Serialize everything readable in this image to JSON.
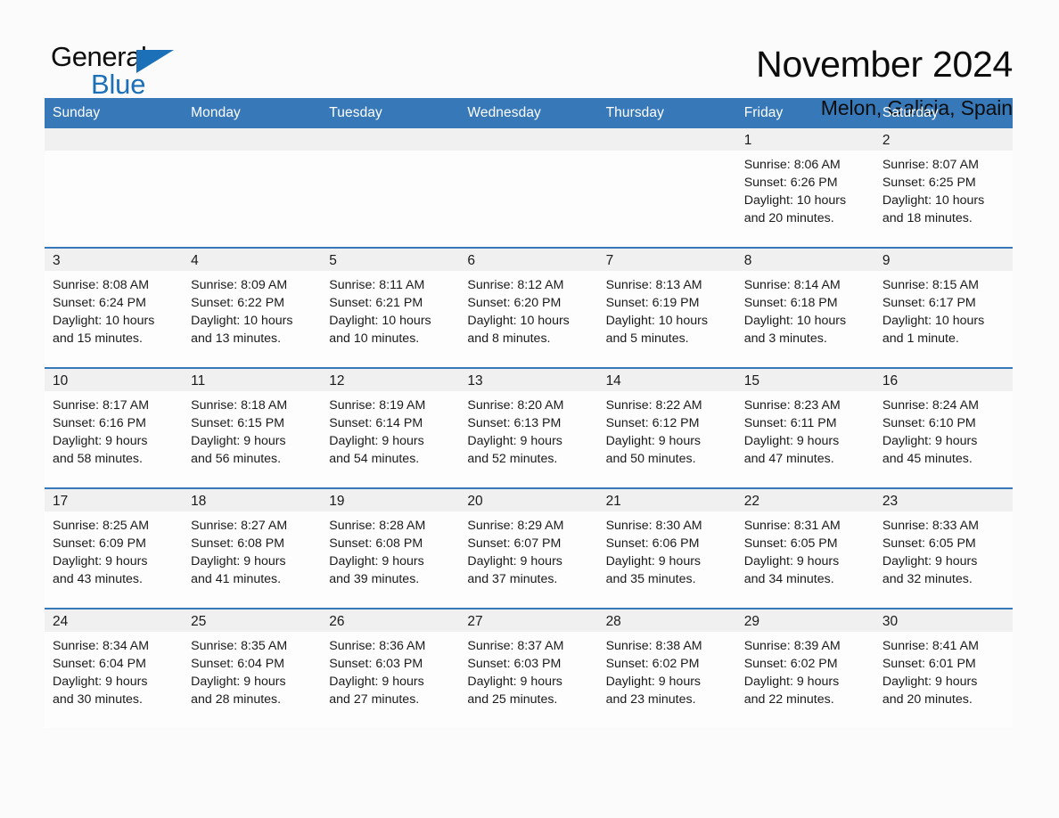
{
  "logo": {
    "word_one": "General",
    "word_two": "Blue",
    "triangle_color": "#1b70b8",
    "text_color": "#0d0d0d"
  },
  "header": {
    "month_title": "November 2024",
    "location": "Melon, Galicia, Spain"
  },
  "theme": {
    "header_blue": "#3778b9",
    "daynum_band": "#f0f0f0",
    "page_background": "#fbfbfb",
    "cell_background": "#fdfdfd",
    "text": "#1a1a1a"
  },
  "weekday_headers": [
    "Sunday",
    "Monday",
    "Tuesday",
    "Wednesday",
    "Thursday",
    "Friday",
    "Saturday"
  ],
  "weeks": [
    [
      {
        "day": "",
        "empty": true
      },
      {
        "day": "",
        "empty": true
      },
      {
        "day": "",
        "empty": true
      },
      {
        "day": "",
        "empty": true
      },
      {
        "day": "",
        "empty": true
      },
      {
        "day": "1",
        "sunrise": "Sunrise: 8:06 AM",
        "sunset": "Sunset: 6:26 PM",
        "daylight_line1": "Daylight: 10 hours",
        "daylight_line2": "and 20 minutes."
      },
      {
        "day": "2",
        "sunrise": "Sunrise: 8:07 AM",
        "sunset": "Sunset: 6:25 PM",
        "daylight_line1": "Daylight: 10 hours",
        "daylight_line2": "and 18 minutes."
      }
    ],
    [
      {
        "day": "3",
        "sunrise": "Sunrise: 8:08 AM",
        "sunset": "Sunset: 6:24 PM",
        "daylight_line1": "Daylight: 10 hours",
        "daylight_line2": "and 15 minutes."
      },
      {
        "day": "4",
        "sunrise": "Sunrise: 8:09 AM",
        "sunset": "Sunset: 6:22 PM",
        "daylight_line1": "Daylight: 10 hours",
        "daylight_line2": "and 13 minutes."
      },
      {
        "day": "5",
        "sunrise": "Sunrise: 8:11 AM",
        "sunset": "Sunset: 6:21 PM",
        "daylight_line1": "Daylight: 10 hours",
        "daylight_line2": "and 10 minutes."
      },
      {
        "day": "6",
        "sunrise": "Sunrise: 8:12 AM",
        "sunset": "Sunset: 6:20 PM",
        "daylight_line1": "Daylight: 10 hours",
        "daylight_line2": "and 8 minutes."
      },
      {
        "day": "7",
        "sunrise": "Sunrise: 8:13 AM",
        "sunset": "Sunset: 6:19 PM",
        "daylight_line1": "Daylight: 10 hours",
        "daylight_line2": "and 5 minutes."
      },
      {
        "day": "8",
        "sunrise": "Sunrise: 8:14 AM",
        "sunset": "Sunset: 6:18 PM",
        "daylight_line1": "Daylight: 10 hours",
        "daylight_line2": "and 3 minutes."
      },
      {
        "day": "9",
        "sunrise": "Sunrise: 8:15 AM",
        "sunset": "Sunset: 6:17 PM",
        "daylight_line1": "Daylight: 10 hours",
        "daylight_line2": "and 1 minute."
      }
    ],
    [
      {
        "day": "10",
        "sunrise": "Sunrise: 8:17 AM",
        "sunset": "Sunset: 6:16 PM",
        "daylight_line1": "Daylight: 9 hours",
        "daylight_line2": "and 58 minutes."
      },
      {
        "day": "11",
        "sunrise": "Sunrise: 8:18 AM",
        "sunset": "Sunset: 6:15 PM",
        "daylight_line1": "Daylight: 9 hours",
        "daylight_line2": "and 56 minutes."
      },
      {
        "day": "12",
        "sunrise": "Sunrise: 8:19 AM",
        "sunset": "Sunset: 6:14 PM",
        "daylight_line1": "Daylight: 9 hours",
        "daylight_line2": "and 54 minutes."
      },
      {
        "day": "13",
        "sunrise": "Sunrise: 8:20 AM",
        "sunset": "Sunset: 6:13 PM",
        "daylight_line1": "Daylight: 9 hours",
        "daylight_line2": "and 52 minutes."
      },
      {
        "day": "14",
        "sunrise": "Sunrise: 8:22 AM",
        "sunset": "Sunset: 6:12 PM",
        "daylight_line1": "Daylight: 9 hours",
        "daylight_line2": "and 50 minutes."
      },
      {
        "day": "15",
        "sunrise": "Sunrise: 8:23 AM",
        "sunset": "Sunset: 6:11 PM",
        "daylight_line1": "Daylight: 9 hours",
        "daylight_line2": "and 47 minutes."
      },
      {
        "day": "16",
        "sunrise": "Sunrise: 8:24 AM",
        "sunset": "Sunset: 6:10 PM",
        "daylight_line1": "Daylight: 9 hours",
        "daylight_line2": "and 45 minutes."
      }
    ],
    [
      {
        "day": "17",
        "sunrise": "Sunrise: 8:25 AM",
        "sunset": "Sunset: 6:09 PM",
        "daylight_line1": "Daylight: 9 hours",
        "daylight_line2": "and 43 minutes."
      },
      {
        "day": "18",
        "sunrise": "Sunrise: 8:27 AM",
        "sunset": "Sunset: 6:08 PM",
        "daylight_line1": "Daylight: 9 hours",
        "daylight_line2": "and 41 minutes."
      },
      {
        "day": "19",
        "sunrise": "Sunrise: 8:28 AM",
        "sunset": "Sunset: 6:08 PM",
        "daylight_line1": "Daylight: 9 hours",
        "daylight_line2": "and 39 minutes."
      },
      {
        "day": "20",
        "sunrise": "Sunrise: 8:29 AM",
        "sunset": "Sunset: 6:07 PM",
        "daylight_line1": "Daylight: 9 hours",
        "daylight_line2": "and 37 minutes."
      },
      {
        "day": "21",
        "sunrise": "Sunrise: 8:30 AM",
        "sunset": "Sunset: 6:06 PM",
        "daylight_line1": "Daylight: 9 hours",
        "daylight_line2": "and 35 minutes."
      },
      {
        "day": "22",
        "sunrise": "Sunrise: 8:31 AM",
        "sunset": "Sunset: 6:05 PM",
        "daylight_line1": "Daylight: 9 hours",
        "daylight_line2": "and 34 minutes."
      },
      {
        "day": "23",
        "sunrise": "Sunrise: 8:33 AM",
        "sunset": "Sunset: 6:05 PM",
        "daylight_line1": "Daylight: 9 hours",
        "daylight_line2": "and 32 minutes."
      }
    ],
    [
      {
        "day": "24",
        "sunrise": "Sunrise: 8:34 AM",
        "sunset": "Sunset: 6:04 PM",
        "daylight_line1": "Daylight: 9 hours",
        "daylight_line2": "and 30 minutes."
      },
      {
        "day": "25",
        "sunrise": "Sunrise: 8:35 AM",
        "sunset": "Sunset: 6:04 PM",
        "daylight_line1": "Daylight: 9 hours",
        "daylight_line2": "and 28 minutes."
      },
      {
        "day": "26",
        "sunrise": "Sunrise: 8:36 AM",
        "sunset": "Sunset: 6:03 PM",
        "daylight_line1": "Daylight: 9 hours",
        "daylight_line2": "and 27 minutes."
      },
      {
        "day": "27",
        "sunrise": "Sunrise: 8:37 AM",
        "sunset": "Sunset: 6:03 PM",
        "daylight_line1": "Daylight: 9 hours",
        "daylight_line2": "and 25 minutes."
      },
      {
        "day": "28",
        "sunrise": "Sunrise: 8:38 AM",
        "sunset": "Sunset: 6:02 PM",
        "daylight_line1": "Daylight: 9 hours",
        "daylight_line2": "and 23 minutes."
      },
      {
        "day": "29",
        "sunrise": "Sunrise: 8:39 AM",
        "sunset": "Sunset: 6:02 PM",
        "daylight_line1": "Daylight: 9 hours",
        "daylight_line2": "and 22 minutes."
      },
      {
        "day": "30",
        "sunrise": "Sunrise: 8:41 AM",
        "sunset": "Sunset: 6:01 PM",
        "daylight_line1": "Daylight: 9 hours",
        "daylight_line2": "and 20 minutes."
      }
    ]
  ]
}
